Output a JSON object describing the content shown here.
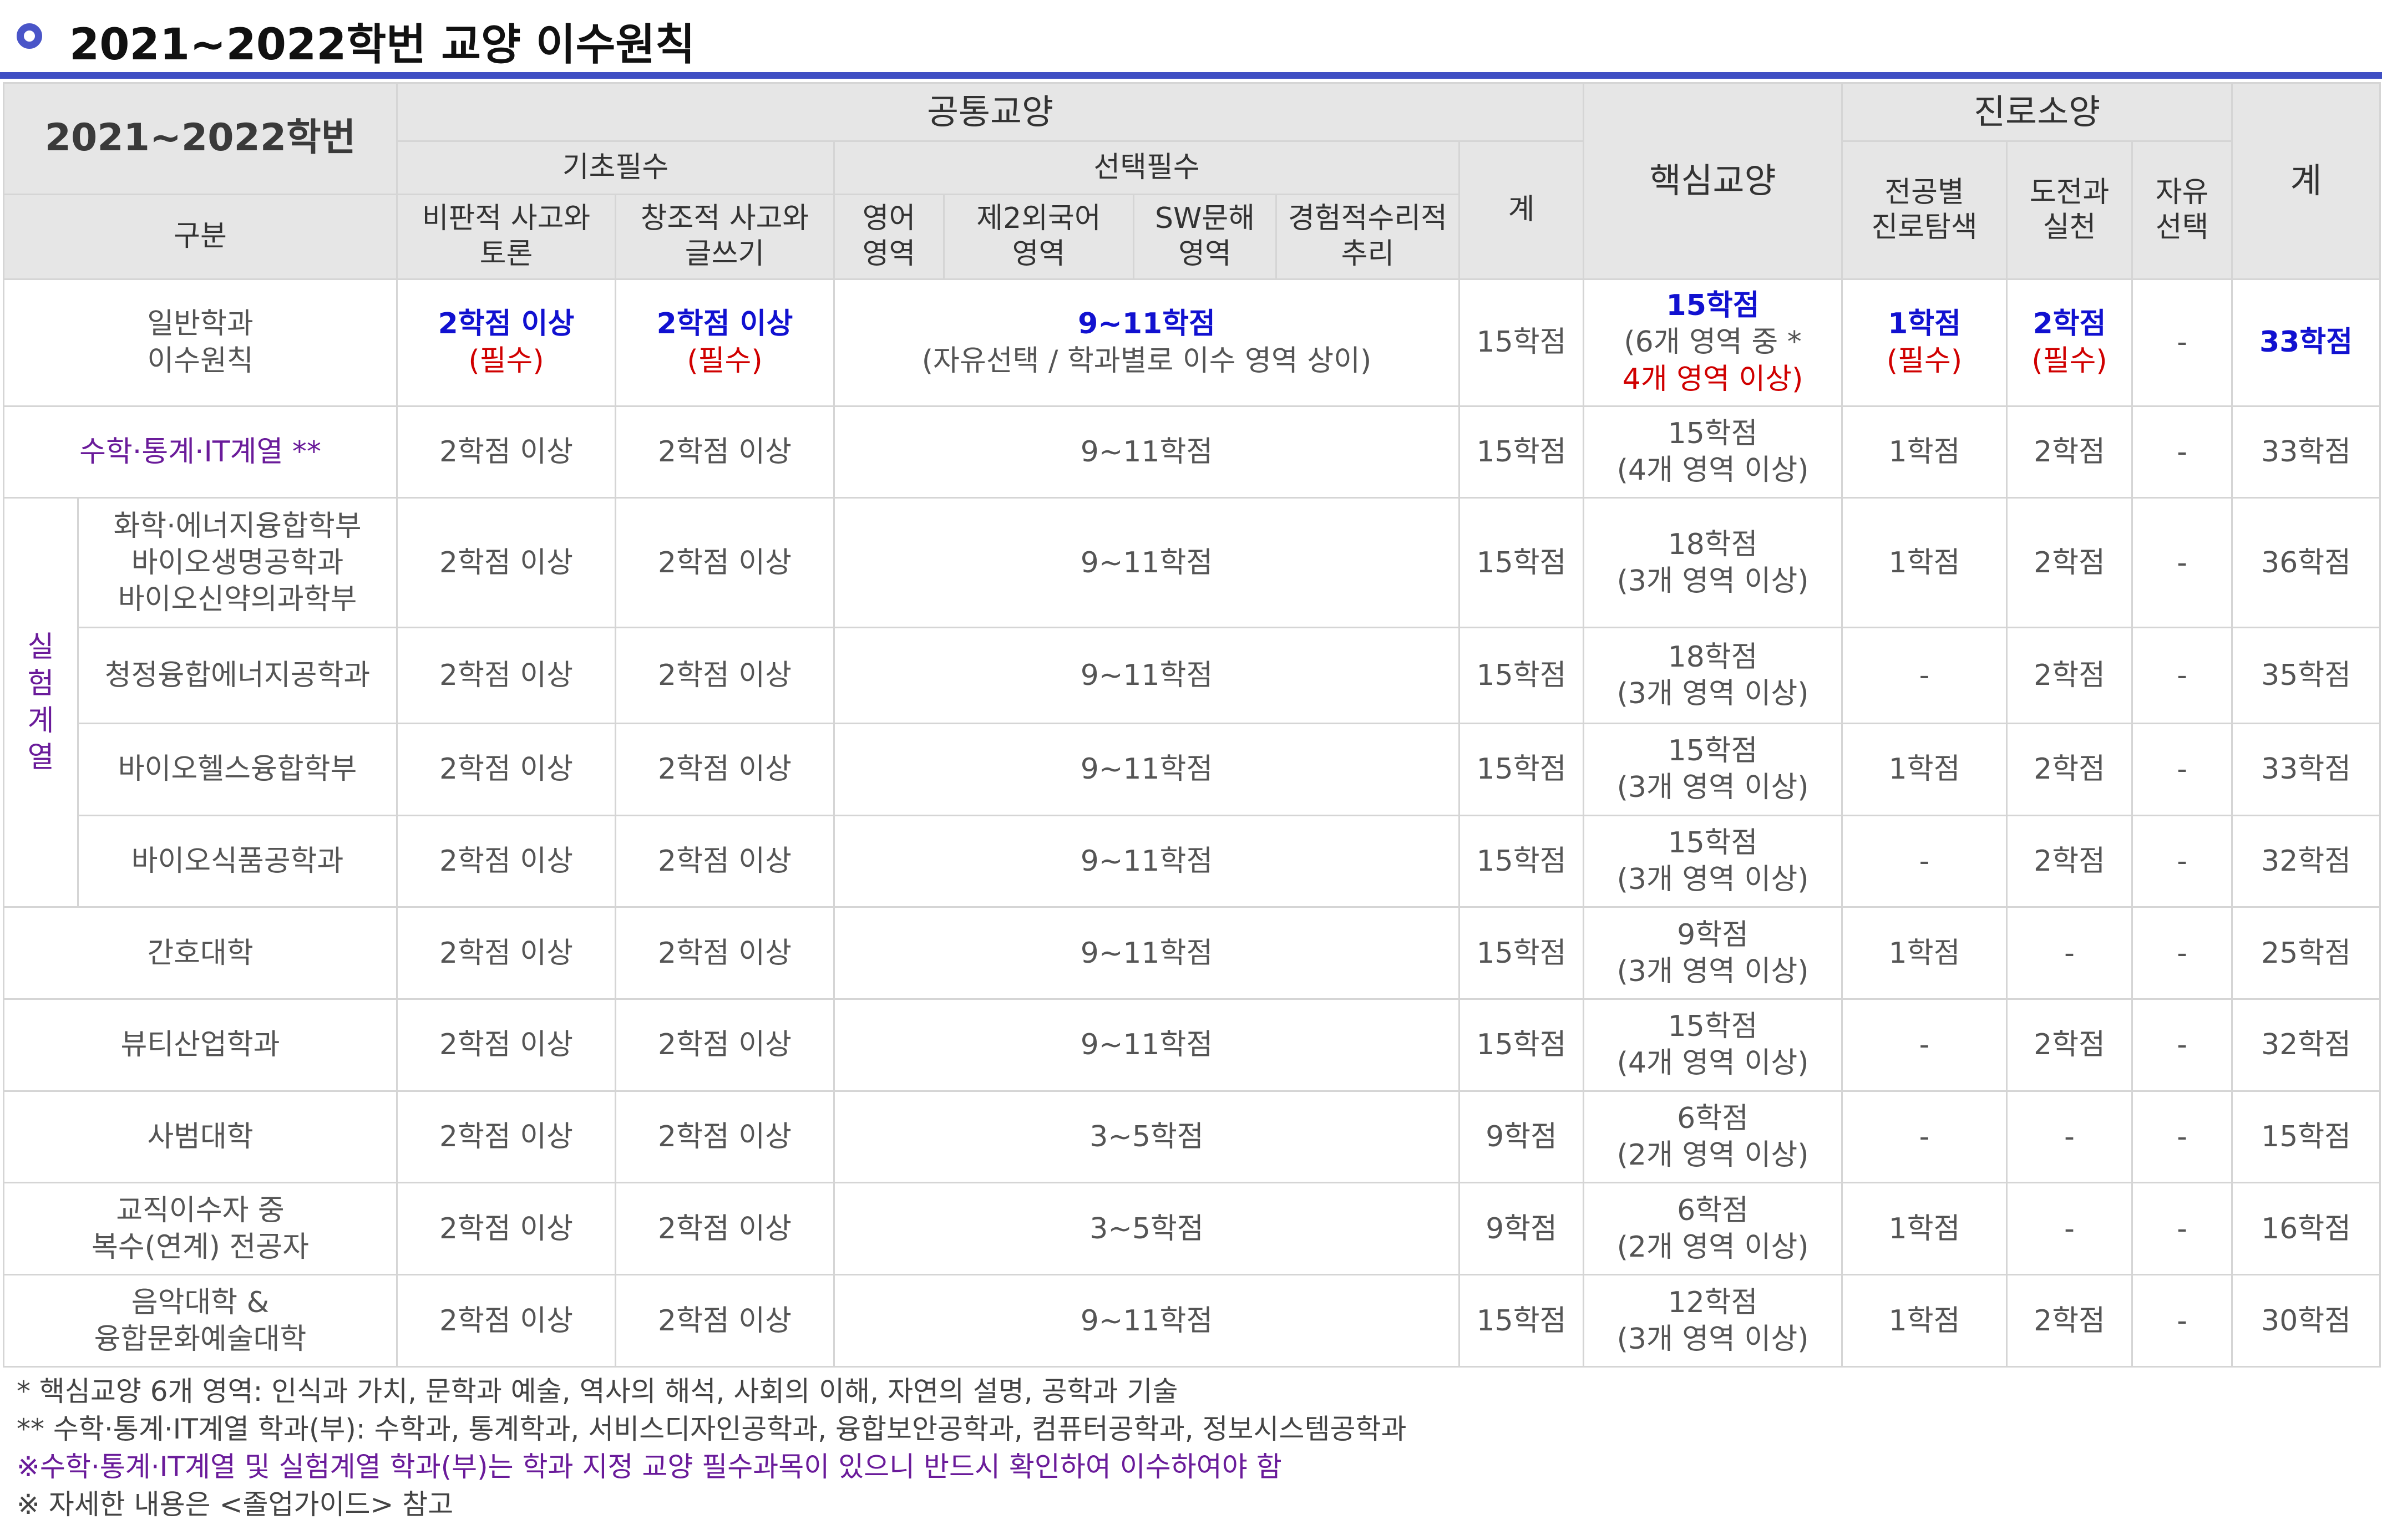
{
  "title": "2021~2022학번 교양 이수원칙",
  "header": {
    "cohort": "2021~2022학번",
    "category": "구분",
    "common": "공통교양",
    "basic_required": "기초필수",
    "elective_required": "선택필수",
    "col_critical": [
      "비판적 사고와",
      "토론"
    ],
    "col_creative": [
      "창조적 사고와",
      "글쓰기"
    ],
    "col_english": [
      "영어",
      "영역"
    ],
    "col_foreign": [
      "제2외국어",
      "영역"
    ],
    "col_sw": [
      "SW문해",
      "영역"
    ],
    "col_math": [
      "경험적수리적",
      "추리"
    ],
    "subtotal": "계",
    "core": "핵심교양",
    "career": "진로소양",
    "col_major_explore": [
      "전공별",
      "진로탐색"
    ],
    "col_challenge": [
      "도전과",
      "실천"
    ],
    "col_free": [
      "자유",
      "선택"
    ],
    "total": "계"
  },
  "experiment_group_label": [
    "실",
    "험",
    "계",
    "열"
  ],
  "general": {
    "name": [
      "일반학과",
      "이수원칙"
    ],
    "critical": "2학점 이상",
    "critical_note": "(필수)",
    "creative": "2학점 이상",
    "creative_note": "(필수)",
    "elective": "9~11학점",
    "elective_note": "(자유선택 / 학과별로 이수 영역 상이)",
    "subtotal": "15학점",
    "core": "15학점",
    "core_note1": "(6개 영역 중 *",
    "core_note2": "4개 영역 이상)",
    "major_explore": "1학점",
    "major_explore_note": "(필수)",
    "challenge": "2학점",
    "challenge_note": "(필수)",
    "free": "-",
    "total": "33학점"
  },
  "rows": [
    {
      "name": [
        "수학·통계·IT계열 **"
      ],
      "critical": "2학점 이상",
      "creative": "2학점 이상",
      "elective": "9~11학점",
      "subtotal": "15학점",
      "core": [
        "15학점",
        "(4개 영역 이상)"
      ],
      "explore": "1학점",
      "challenge": "2학점",
      "free": "-",
      "total": "33학점"
    },
    {
      "name": [
        "화학·에너지융합학부",
        "바이오생명공학과",
        "바이오신약의과학부"
      ],
      "critical": "2학점 이상",
      "creative": "2학점 이상",
      "elective": "9~11학점",
      "subtotal": "15학점",
      "core": [
        "18학점",
        "(3개 영역 이상)"
      ],
      "explore": "1학점",
      "challenge": "2학점",
      "free": "-",
      "total": "36학점"
    },
    {
      "name": [
        "청정융합에너지공학과"
      ],
      "critical": "2학점 이상",
      "creative": "2학점 이상",
      "elective": "9~11학점",
      "subtotal": "15학점",
      "core": [
        "18학점",
        "(3개 영역 이상)"
      ],
      "explore": "-",
      "challenge": "2학점",
      "free": "-",
      "total": "35학점"
    },
    {
      "name": [
        "바이오헬스융합학부"
      ],
      "critical": "2학점 이상",
      "creative": "2학점 이상",
      "elective": "9~11학점",
      "subtotal": "15학점",
      "core": [
        "15학점",
        "(3개 영역 이상)"
      ],
      "explore": "1학점",
      "challenge": "2학점",
      "free": "-",
      "total": "33학점"
    },
    {
      "name": [
        "바이오식품공학과"
      ],
      "critical": "2학점 이상",
      "creative": "2학점 이상",
      "elective": "9~11학점",
      "subtotal": "15학점",
      "core": [
        "15학점",
        "(3개 영역 이상)"
      ],
      "explore": "-",
      "challenge": "2학점",
      "free": "-",
      "total": "32학점"
    },
    {
      "name": [
        "간호대학"
      ],
      "critical": "2학점 이상",
      "creative": "2학점 이상",
      "elective": "9~11학점",
      "subtotal": "15학점",
      "core": [
        "9학점",
        "(3개 영역 이상)"
      ],
      "explore": "1학점",
      "challenge": "-",
      "free": "-",
      "total": "25학점"
    },
    {
      "name": [
        "뷰티산업학과"
      ],
      "critical": "2학점 이상",
      "creative": "2학점 이상",
      "elective": "9~11학점",
      "subtotal": "15학점",
      "core": [
        "15학점",
        "(4개 영역 이상)"
      ],
      "explore": "-",
      "challenge": "2학점",
      "free": "-",
      "total": "32학점"
    },
    {
      "name": [
        "사범대학"
      ],
      "critical": "2학점 이상",
      "creative": "2학점 이상",
      "elective": "3~5학점",
      "subtotal": "9학점",
      "core": [
        "6학점",
        "(2개 영역 이상)"
      ],
      "explore": "-",
      "challenge": "-",
      "free": "-",
      "total": "15학점"
    },
    {
      "name": [
        "교직이수자 중",
        "복수(연계) 전공자"
      ],
      "critical": "2학점 이상",
      "creative": "2학점 이상",
      "elective": "3~5학점",
      "subtotal": "9학점",
      "core": [
        "6학점",
        "(2개 영역 이상)"
      ],
      "explore": "1학점",
      "challenge": "-",
      "free": "-",
      "total": "16학점"
    },
    {
      "name": [
        "음악대학 &",
        "융합문화예술대학"
      ],
      "critical": "2학점 이상",
      "creative": "2학점 이상",
      "elective": "9~11학점",
      "subtotal": "15학점",
      "core": [
        "12학점",
        "(3개 영역 이상)"
      ],
      "explore": "1학점",
      "challenge": "2학점",
      "free": "-",
      "total": "30학점"
    }
  ],
  "notes": [
    "*  핵심교양 6개 영역: 인식과 가치, 문학과 예술, 역사의 해석, 사회의 이해, 자연의 설명, 공학과 기술",
    "**  수학·통계·IT계열 학과(부): 수학과, 통계학과, 서비스디자인공학과, 융합보안공학과, 컴퓨터공학과, 정보시스템공학과",
    "※수학·통계·IT계열 및 실험계열 학과(부)는 학과 지정 교양 필수과목이 있으니 반드시 확인하여 이수하여야 함",
    "※  자세한  내용은 <졸업가이드> 참고"
  ],
  "colors": {
    "accent": "#3F4FC4",
    "highlight_blue": "#1111d0",
    "required_red": "#d00000",
    "purple": "#6a1b9a",
    "header_bg": "#e6e6e6"
  },
  "icons": {
    "title_marker": "circle-bullet-icon"
  }
}
